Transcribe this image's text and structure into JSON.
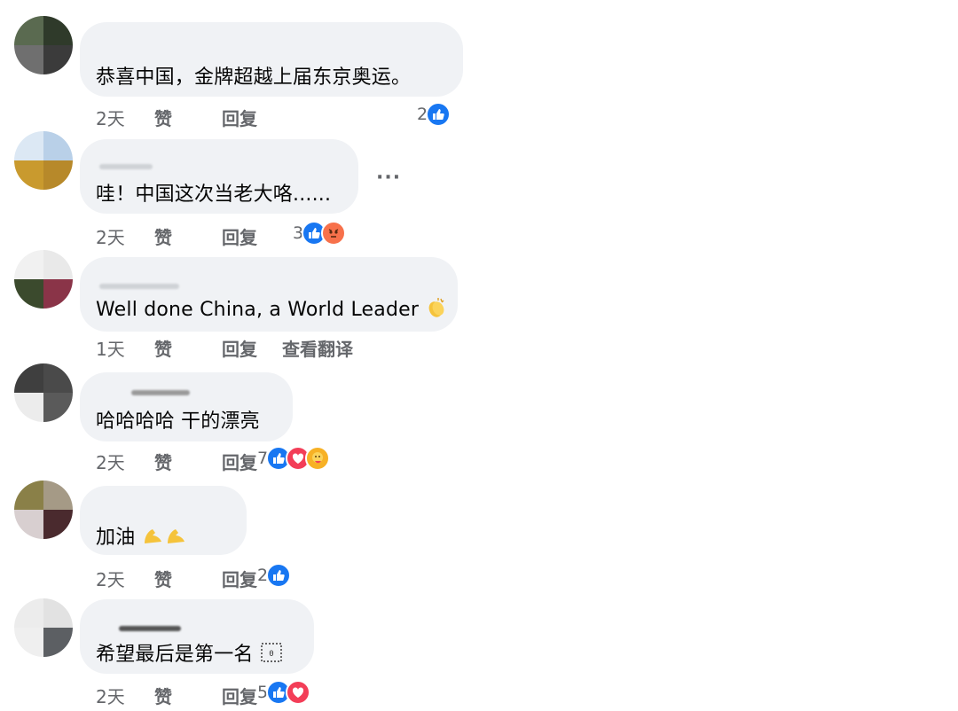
{
  "colors": {
    "bubble": "#f0f2f5",
    "meta": "#65676b",
    "like": "#1877f2",
    "love": "#f33e58",
    "angry": "#f7714b",
    "care": "#f7b125"
  },
  "more_label": "···",
  "comments": [
    {
      "text": "恭喜中国，金牌超越上届东京奥运。",
      "time": "2天",
      "like": "赞",
      "reply": "回复",
      "reaction_count": "2",
      "reactions": [
        "like-icon"
      ]
    },
    {
      "text": "哇！中国这次当老大咯......",
      "time": "2天",
      "like": "赞",
      "reply": "回复",
      "reaction_count": "3",
      "reactions": [
        "like-icon",
        "angry-icon"
      ]
    },
    {
      "text": "Well done China, a World Leader",
      "emoji": "clapping-hands-icon",
      "time": "1天",
      "like": "赞",
      "reply": "回复",
      "translate": "查看翻译"
    },
    {
      "text": "哈哈哈哈 干的漂亮",
      "time": "2天",
      "like": "赞",
      "reply": "回复",
      "reaction_count": "7",
      "reactions": [
        "like-icon",
        "love-icon",
        "care-icon"
      ]
    },
    {
      "text": "加油",
      "emoji": "flexed-biceps-icon",
      "time": "2天",
      "like": "赞",
      "reply": "回复",
      "reaction_count": "2",
      "reactions": [
        "like-icon"
      ]
    },
    {
      "text": "希望最后是第一名",
      "emoji": "missing-glyph-icon",
      "time": "2天",
      "like": "赞",
      "reply": "回复",
      "reaction_count": "5",
      "reactions": [
        "like-icon",
        "love-icon"
      ]
    }
  ]
}
